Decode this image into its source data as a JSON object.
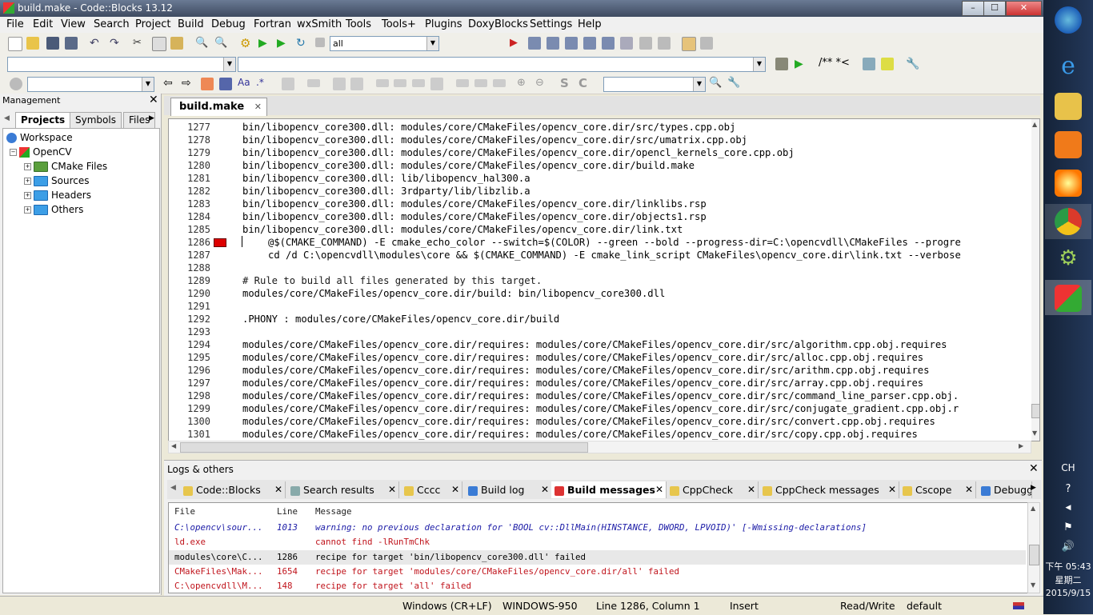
{
  "window": {
    "title": "build.make - Code::Blocks 13.12",
    "min": "–",
    "max": "☐",
    "close": "✕"
  },
  "menu": [
    "File",
    "Edit",
    "View",
    "Search",
    "Project",
    "Build",
    "Debug",
    "Fortran",
    "wxSmith",
    "Tools",
    "Tools+",
    "Plugins",
    "DoxyBlocks",
    "Settings",
    "Help"
  ],
  "toolbar": {
    "build_target": "all",
    "doxy_comment": "/** *<"
  },
  "management": {
    "title": "Management",
    "tabs": [
      "Projects",
      "Symbols",
      "Files"
    ],
    "tree": {
      "workspace": "Workspace",
      "project": "OpenCV",
      "folders": [
        "CMake Files",
        "Sources",
        "Headers",
        "Others"
      ]
    }
  },
  "editor": {
    "tab": "build.make",
    "lines": [
      {
        "n": "1277",
        "t": "bin/libopencv_core300.dll: modules/core/CMakeFiles/opencv_core.dir/src/types.cpp.obj"
      },
      {
        "n": "1278",
        "t": "bin/libopencv_core300.dll: modules/core/CMakeFiles/opencv_core.dir/src/umatrix.cpp.obj"
      },
      {
        "n": "1279",
        "t": "bin/libopencv_core300.dll: modules/core/CMakeFiles/opencv_core.dir/opencl_kernels_core.cpp.obj"
      },
      {
        "n": "1280",
        "t": "bin/libopencv_core300.dll: modules/core/CMakeFiles/opencv_core.dir/build.make"
      },
      {
        "n": "1281",
        "t": "bin/libopencv_core300.dll: lib/libopencv_hal300.a"
      },
      {
        "n": "1282",
        "t": "bin/libopencv_core300.dll: 3rdparty/lib/libzlib.a"
      },
      {
        "n": "1283",
        "t": "bin/libopencv_core300.dll: modules/core/CMakeFiles/opencv_core.dir/linklibs.rsp"
      },
      {
        "n": "1284",
        "t": "bin/libopencv_core300.dll: modules/core/CMakeFiles/opencv_core.dir/objects1.rsp"
      },
      {
        "n": "1285",
        "t": "bin/libopencv_core300.dll: modules/core/CMakeFiles/opencv_core.dir/link.txt"
      },
      {
        "n": "1286",
        "t": "\t@$(CMAKE_COMMAND) -E cmake_echo_color --switch=$(COLOR) --green --bold --progress-dir=C:\\opencvdll\\CMakeFiles --progre"
      },
      {
        "n": "1287",
        "t": "\tcd /d C:\\opencvdll\\modules\\core && $(CMAKE_COMMAND) -E cmake_link_script CMakeFiles\\opencv_core.dir\\link.txt --verbose"
      },
      {
        "n": "1288",
        "t": ""
      },
      {
        "n": "1289",
        "t": "# Rule to build all files generated by this target."
      },
      {
        "n": "1290",
        "t": "modules/core/CMakeFiles/opencv_core.dir/build: bin/libopencv_core300.dll"
      },
      {
        "n": "1291",
        "t": ""
      },
      {
        "n": "1292",
        "t": ".PHONY : modules/core/CMakeFiles/opencv_core.dir/build"
      },
      {
        "n": "1293",
        "t": ""
      },
      {
        "n": "1294",
        "t": "modules/core/CMakeFiles/opencv_core.dir/requires: modules/core/CMakeFiles/opencv_core.dir/src/algorithm.cpp.obj.requires"
      },
      {
        "n": "1295",
        "t": "modules/core/CMakeFiles/opencv_core.dir/requires: modules/core/CMakeFiles/opencv_core.dir/src/alloc.cpp.obj.requires"
      },
      {
        "n": "1296",
        "t": "modules/core/CMakeFiles/opencv_core.dir/requires: modules/core/CMakeFiles/opencv_core.dir/src/arithm.cpp.obj.requires"
      },
      {
        "n": "1297",
        "t": "modules/core/CMakeFiles/opencv_core.dir/requires: modules/core/CMakeFiles/opencv_core.dir/src/array.cpp.obj.requires"
      },
      {
        "n": "1298",
        "t": "modules/core/CMakeFiles/opencv_core.dir/requires: modules/core/CMakeFiles/opencv_core.dir/src/command_line_parser.cpp.obj."
      },
      {
        "n": "1299",
        "t": "modules/core/CMakeFiles/opencv_core.dir/requires: modules/core/CMakeFiles/opencv_core.dir/src/conjugate_gradient.cpp.obj.r"
      },
      {
        "n": "1300",
        "t": "modules/core/CMakeFiles/opencv_core.dir/requires: modules/core/CMakeFiles/opencv_core.dir/src/convert.cpp.obj.requires"
      },
      {
        "n": "1301",
        "t": "modules/core/CMakeFiles/opencv_core.dir/requires: modules/core/CMakeFiles/opencv_core.dir/src/copy.cpp.obj.requires"
      }
    ],
    "error_marker_line": "1286"
  },
  "logs": {
    "title": "Logs & others",
    "tabs": [
      "Code::Blocks",
      "Search results",
      "Cccc",
      "Build log",
      "Build messages",
      "CppCheck",
      "CppCheck messages",
      "Cscope",
      "Debugg"
    ],
    "active_tab": "Build messages",
    "columns": [
      "File",
      "Line",
      "Message"
    ],
    "rows": [
      {
        "file": "C:\\opencv\\sour...",
        "line": "1013",
        "msg": "warning: no previous declaration for 'BOOL cv::DllMain(HINSTANCE, DWORD, LPVOID)' [-Wmissing-declarations]",
        "kind": "warning"
      },
      {
        "file": "ld.exe",
        "line": "",
        "msg": "cannot find -lRunTmChk",
        "kind": "error"
      },
      {
        "file": "modules\\core\\C...",
        "line": "1286",
        "msg": "recipe for target 'bin/libopencv_core300.dll' failed",
        "kind": "selected"
      },
      {
        "file": "CMakeFiles\\Mak...",
        "line": "1654",
        "msg": "recipe for target 'modules/core/CMakeFiles/opencv_core.dir/all' failed",
        "kind": "error"
      },
      {
        "file": "C:\\opencvdll\\M...",
        "line": "148",
        "msg": "recipe for target 'all' failed",
        "kind": "error"
      }
    ]
  },
  "status": {
    "eol": "Windows (CR+LF)",
    "encoding": "WINDOWS-950",
    "position": "Line 1286, Column 1",
    "mode": "Insert",
    "access": "Read/Write",
    "lang": "default"
  },
  "taskbar": {
    "ime": "CH",
    "time": "下午 05:43",
    "day": "星期二",
    "date": "2015/9/15"
  },
  "colors": {
    "error": "#c0141c",
    "warning": "#1a1aa6",
    "accent": "#2d62c8"
  }
}
